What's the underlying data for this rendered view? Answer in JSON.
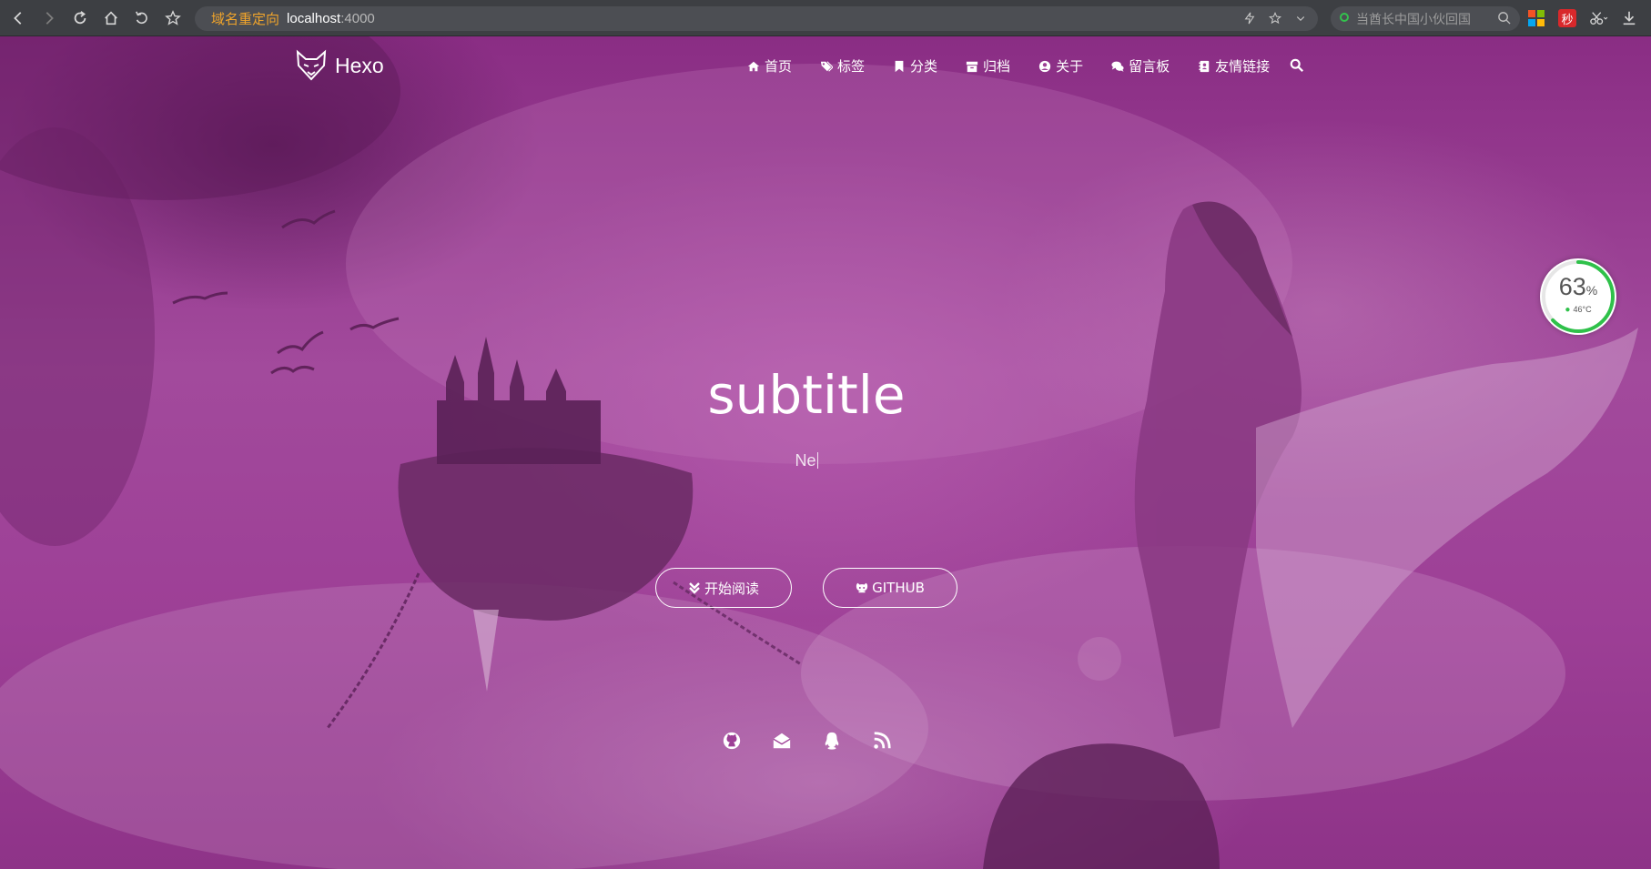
{
  "browser": {
    "address": {
      "redirect_label": "域名重定向",
      "host": "localhost",
      "port": ":4000"
    },
    "search_placeholder": "当酋长中国小伙回国",
    "miao_label": "秒"
  },
  "site": {
    "brand": "Hexo",
    "nav": [
      {
        "label": "首页",
        "icon": "home-icon"
      },
      {
        "label": "标签",
        "icon": "tags-icon"
      },
      {
        "label": "分类",
        "icon": "bookmark-icon"
      },
      {
        "label": "归档",
        "icon": "archive-icon"
      },
      {
        "label": "关于",
        "icon": "user-circle-icon"
      },
      {
        "label": "留言板",
        "icon": "comments-icon"
      },
      {
        "label": "友情链接",
        "icon": "address-book-icon"
      }
    ],
    "hero": {
      "title": "subtitle",
      "typed_text": "Ne"
    },
    "buttons": {
      "read": "开始阅读",
      "github": "GITHUB"
    },
    "social": [
      "github-icon",
      "envelope-icon",
      "qq-icon",
      "rss-icon"
    ]
  },
  "monitor": {
    "percent": "63",
    "percent_sign": "%",
    "temperature": "46°C",
    "percent_value": 63,
    "ring_color": "#2fc14a"
  },
  "colors": {
    "hero_tint": "#9d3f96",
    "address_redirect": "#f0a42b"
  }
}
